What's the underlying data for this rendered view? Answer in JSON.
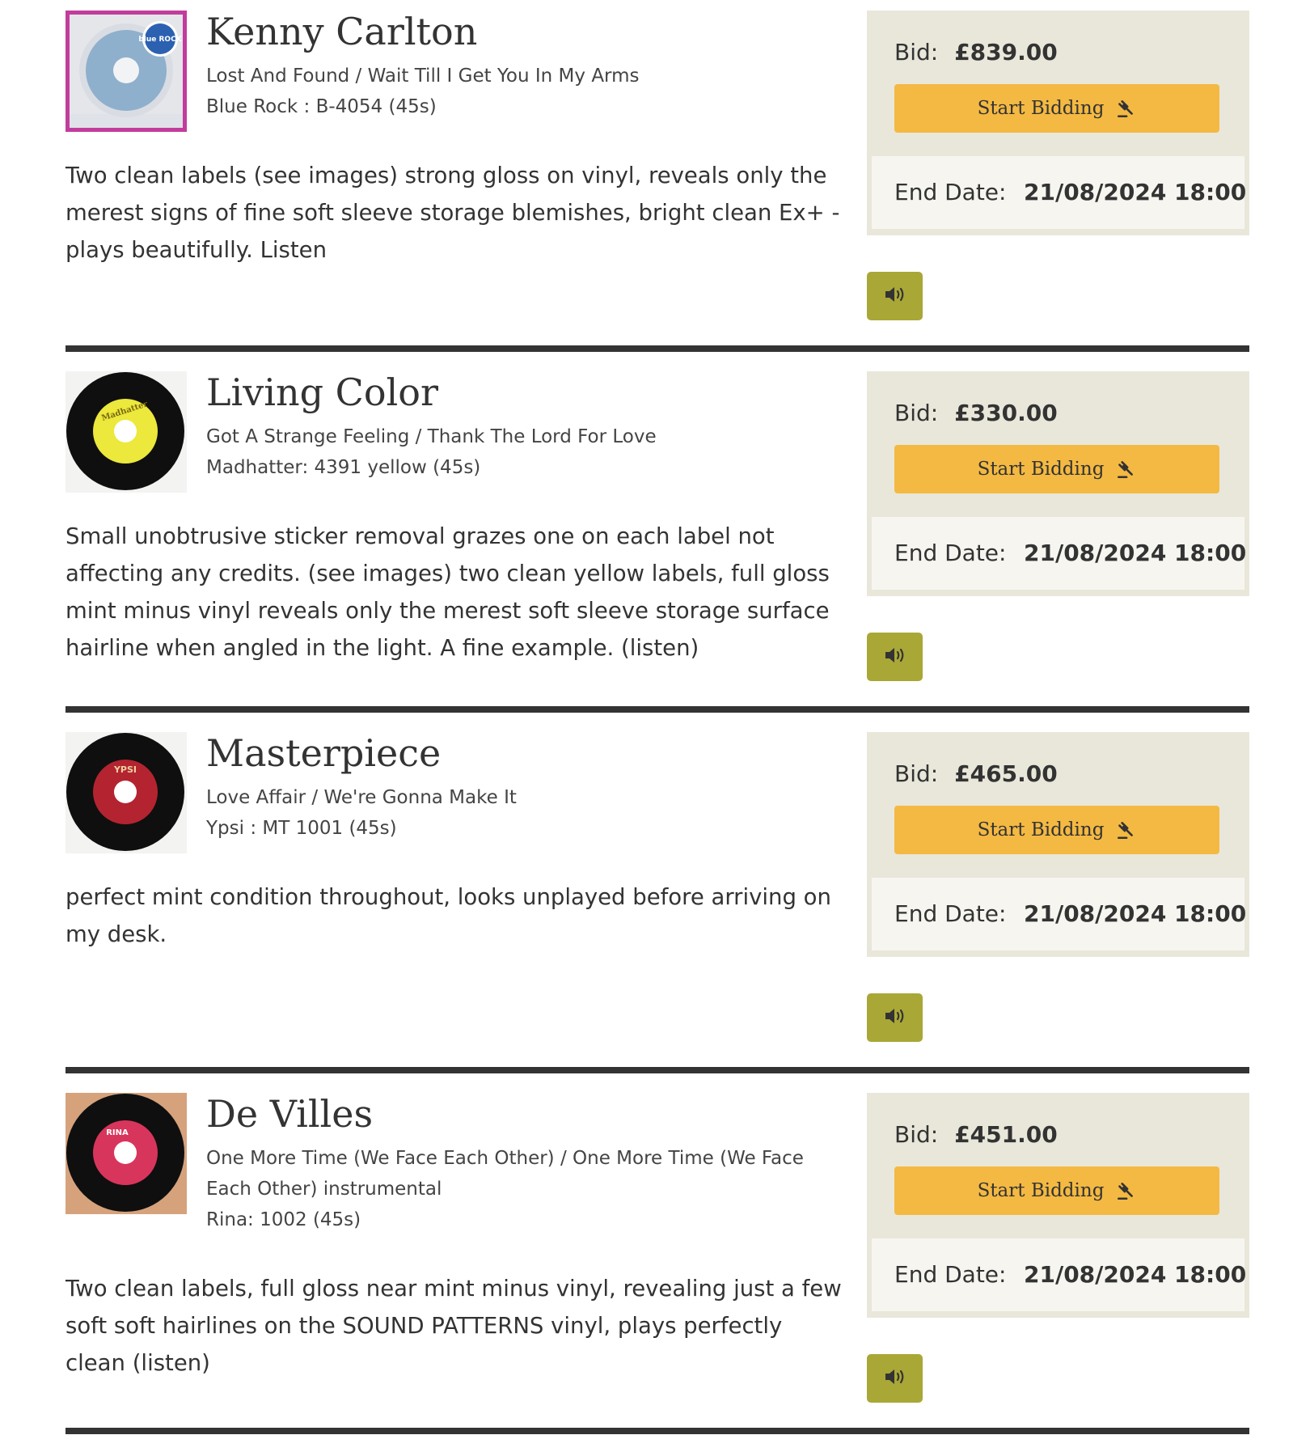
{
  "ui": {
    "bid_label": "Bid:",
    "bid_button_label": "Start Bidding",
    "end_date_label": "End Date:"
  },
  "colors": {
    "panel_bg": "#e9e7da",
    "end_date_bg": "#f6f5f0",
    "bid_button": "#f4b942",
    "listen_button": "#a9a736",
    "divider": "#333333"
  },
  "lots": [
    {
      "artist": "Kenny Carlton",
      "title": "Lost And Found / Wait Till I Get You In My Arms",
      "label": "Blue Rock : B-4054 (45s)",
      "description": "Two clean labels (see images) strong gloss on vinyl, reveals only the merest signs of fine soft sleeve storage blemishes, bright clean Ex+ - plays beautifully. Listen",
      "bid": "£839.00",
      "end_date": "21/08/2024 18:00",
      "thumb_text": "blue ROCK"
    },
    {
      "artist": "Living Color",
      "title": "Got A Strange Feeling / Thank The Lord For Love",
      "label": "Madhatter: 4391 yellow (45s)",
      "description": "Small unobtrusive sticker removal grazes one on each label not affecting any credits. (see images) two clean yellow labels, full gloss mint minus vinyl reveals only the merest soft sleeve storage surface hairline when angled in the light. A fine example. (listen)",
      "bid": "£330.00",
      "end_date": "21/08/2024 18:00",
      "thumb_text": "Madhatter"
    },
    {
      "artist": "Masterpiece",
      "title": "Love Affair / We're Gonna Make It",
      "label": "Ypsi : MT 1001 (45s)",
      "description": "perfect mint condition throughout, looks unplayed before arriving on my desk.",
      "bid": "£465.00",
      "end_date": "21/08/2024 18:00",
      "thumb_text": "YPSI"
    },
    {
      "artist": "De Villes",
      "title": "One More Time (We Face Each Other) / One More Time (We Face Each Other) instrumental",
      "label": "Rina: 1002 (45s)",
      "description": "Two clean labels, full gloss near mint minus vinyl, revealing just a few soft soft hairlines on the SOUND PATTERNS vinyl, plays perfectly clean (listen)",
      "bid": "£451.00",
      "end_date": "21/08/2024 18:00",
      "thumb_text": "RINA"
    }
  ]
}
